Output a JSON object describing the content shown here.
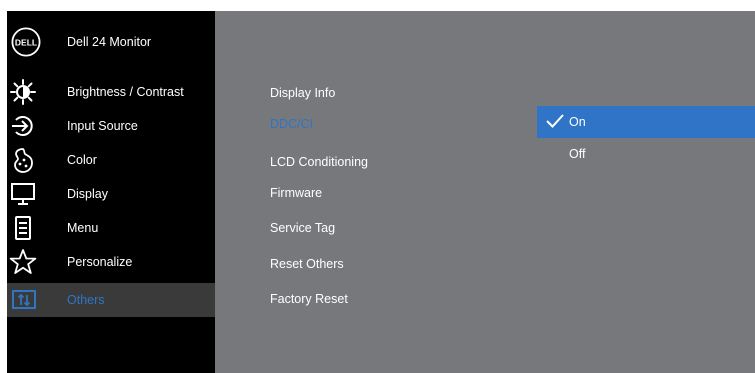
{
  "header": {
    "title": "Dell 24 Monitor",
    "logo_text": "DELL"
  },
  "menu": [
    {
      "label": "Brightness / Contrast",
      "icon": "brightness-icon",
      "selected": false
    },
    {
      "label": "Input Source",
      "icon": "input-source-icon",
      "selected": false
    },
    {
      "label": "Color",
      "icon": "color-icon",
      "selected": false
    },
    {
      "label": "Display",
      "icon": "display-icon",
      "selected": false
    },
    {
      "label": "Menu",
      "icon": "menu-icon",
      "selected": false
    },
    {
      "label": "Personalize",
      "icon": "star-icon",
      "selected": false
    },
    {
      "label": "Others",
      "icon": "others-icon",
      "selected": true
    }
  ],
  "others_options": [
    {
      "label": "Display Info",
      "selected": false
    },
    {
      "label": "DDC/CI",
      "selected": true
    },
    {
      "label": "LCD Conditioning",
      "selected": false
    },
    {
      "label": "Firmware",
      "selected": false
    },
    {
      "label": "Service Tag",
      "selected": false
    },
    {
      "label": "Reset Others",
      "selected": false
    },
    {
      "label": "Factory Reset",
      "selected": false
    }
  ],
  "ddcci_choices": [
    {
      "label": "On",
      "selected": true
    },
    {
      "label": "Off",
      "selected": false
    }
  ],
  "colors": {
    "panel": "#77787b",
    "sidebar": "#000000",
    "accent": "#2f74c6",
    "text": "#ffffff"
  }
}
